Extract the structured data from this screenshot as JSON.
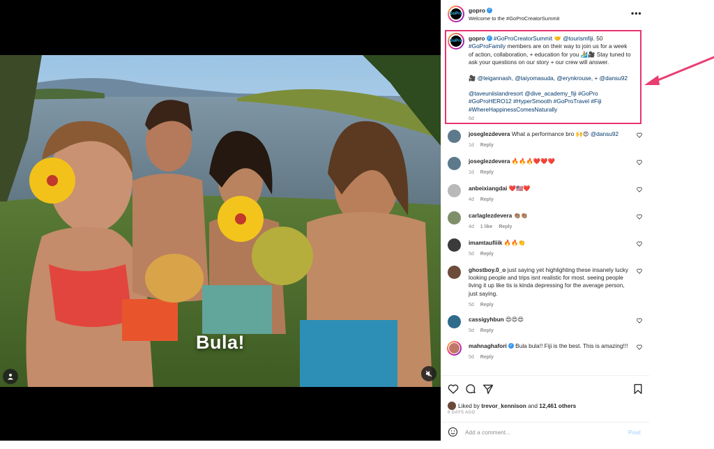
{
  "media": {
    "overlay_caption": "Bula!"
  },
  "header": {
    "username": "gopro",
    "subtitle": "Welcome to the #GoProCreatorSummit",
    "more": "•••"
  },
  "post": {
    "username": "gopro",
    "tag1": "#GoProCreatorSummit",
    "emoji1": "🤝",
    "mention1": "@tourismfiji",
    "text1": ". 50",
    "tag2": "#GoProFamily",
    "text2": " members are on their way to join us for a week of action, collaboration, + education for you 🏄🎥 Stay tuned to ask your questions on our story + our crew will answer.",
    "camera": "🎥",
    "mentions": [
      "@teigannash",
      "@taiyomasuda",
      "@erynkrouse"
    ],
    "mention_last_prefix": "+",
    "mention_last": "@dansu92",
    "tags_line": [
      "@taveuniislandresort",
      "@dive_academy_fiji",
      "#GoPro",
      "#GoProHERO12",
      "#HyperSmooth",
      "#GoProTravel",
      "#Fiji",
      "#WhereHappinessComesNaturally"
    ],
    "age": "6d"
  },
  "comments": [
    {
      "user": "joseglezdevera",
      "text": "What a performance bro 🙌😍 ",
      "mention": "@dansu92",
      "age": "1d",
      "likes": "",
      "reply": "Reply",
      "avatar": "#5d7a8c"
    },
    {
      "user": "joseglezdevera",
      "text": "🔥🔥🔥❤️❤️❤️",
      "mention": "",
      "age": "1d",
      "likes": "",
      "reply": "Reply",
      "avatar": "#5d7a8c"
    },
    {
      "user": "anbeixiangdai",
      "text": "❤️🇺🇸❤️",
      "mention": "",
      "age": "4d",
      "likes": "",
      "reply": "Reply",
      "avatar": "#b9b9b9"
    },
    {
      "user": "carlaglezdevera",
      "text": "👏🏽👏🏽",
      "mention": "",
      "age": "4d",
      "likes": "1 like",
      "reply": "Reply",
      "avatar": "#7f8f6a"
    },
    {
      "user": "imamtaufiiik",
      "text": "🔥🔥👏",
      "mention": "",
      "age": "5d",
      "likes": "",
      "reply": "Reply",
      "avatar": "#3b3b3b"
    },
    {
      "user": "ghostboy.0_o",
      "text": "just saying yet highlighting these insanely lucky looking people and trips isnt realistic for most. seeing people living it up like tis is kinda depressing for the average person, just saying.",
      "mention": "",
      "age": "5d",
      "likes": "",
      "reply": "Reply",
      "avatar": "#6d4c3a"
    },
    {
      "user": "cassigyhbun",
      "text": "😍😍😍",
      "mention": "",
      "age": "5d",
      "likes": "",
      "reply": "Reply",
      "avatar": "#2f6b8a"
    },
    {
      "user": "mahnaghafori",
      "text": "Bula bula!! Fiji is the best. This is amazing!!!",
      "mention": "",
      "age": "5d",
      "likes": "",
      "reply": "Reply",
      "avatar": "#c2766a",
      "verified": true
    }
  ],
  "footer": {
    "liked_prefix": "Liked by ",
    "liked_user": "trevor_kennison",
    "liked_mid": " and ",
    "liked_count": "12,461 others",
    "date": "6 DAYS AGO",
    "add_comment_placeholder": "Add a comment...",
    "post_button": "Post"
  },
  "colors": {
    "highlight_box": "#e7336e",
    "link": "#00376b",
    "verified": "#3897f0",
    "arrow": "#e83e72"
  },
  "icons": [
    "user-tag-icon",
    "mute-icon",
    "more-icon",
    "heart-icon",
    "comment-icon",
    "share-icon",
    "bookmark-icon",
    "emoji-icon",
    "verified-icon"
  ]
}
